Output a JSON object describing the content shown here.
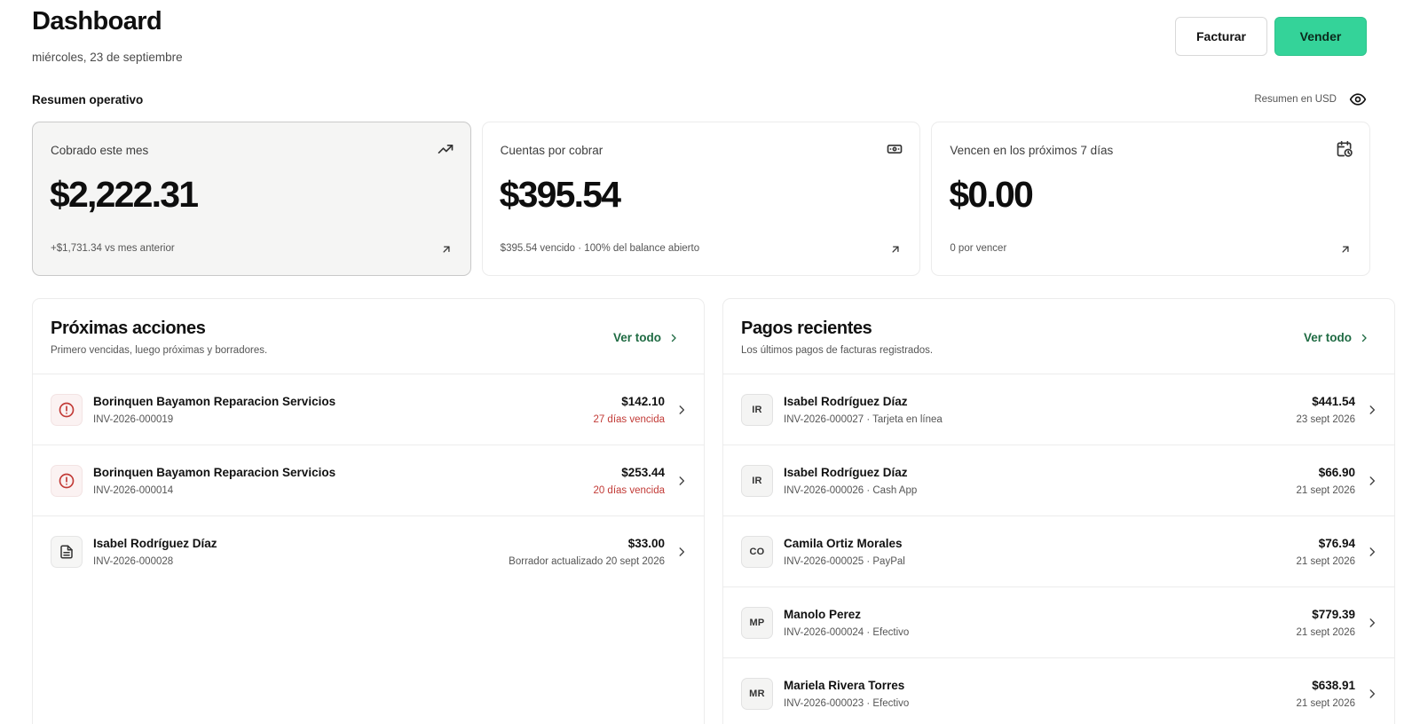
{
  "header": {
    "title": "Dashboard",
    "date": "miércoles, 23 de septiembre",
    "facturar_label": "Facturar",
    "vender_label": "Vender",
    "accent_color": "#34d399"
  },
  "overview": {
    "title": "Resumen operativo",
    "currency_label": "Resumen en USD",
    "toggle_icon": "eye-icon"
  },
  "cards": [
    {
      "label": "Cobrado este mes",
      "value": "$2,222.31",
      "footer": "+$1,731.34 vs mes anterior",
      "icon": "trending-up-icon",
      "active": true
    },
    {
      "label": "Cuentas por cobrar",
      "value": "$395.54",
      "footer": "$395.54 vencido · 100% del balance abierto",
      "icon": "banknote-icon",
      "active": false
    },
    {
      "label": "Vencen en los próximos 7 días",
      "value": "$0.00",
      "footer": "0 por vencer",
      "icon": "calendar-clock-icon",
      "active": false
    }
  ],
  "next_actions": {
    "title": "Próximas acciones",
    "subtitle": "Primero vencidas, luego próximas y borradores.",
    "see_all": "Ver todo",
    "items": [
      {
        "name": "Borinquen Bayamon Reparacion Servicios",
        "invoice": "INV-2026-000019",
        "amount": "$142.10",
        "status": "27 días vencida",
        "kind": "overdue",
        "icon": "alert-circle-icon"
      },
      {
        "name": "Borinquen Bayamon Reparacion Servicios",
        "invoice": "INV-2026-000014",
        "amount": "$253.44",
        "status": "20 días vencida",
        "kind": "overdue",
        "icon": "alert-circle-icon"
      },
      {
        "name": "Isabel Rodríguez Díaz",
        "invoice": "INV-2026-000028",
        "amount": "$33.00",
        "status": "Borrador actualizado 20 sept 2026",
        "kind": "draft",
        "icon": "document-icon"
      }
    ]
  },
  "recent_payments": {
    "title": "Pagos recientes",
    "subtitle": "Los últimos pagos de facturas registrados.",
    "see_all": "Ver todo",
    "items": [
      {
        "initials": "IR",
        "name": "Isabel Rodríguez Díaz",
        "detail": "INV-2026-000027 · Tarjeta en línea",
        "amount": "$441.54",
        "date": "23 sept 2026"
      },
      {
        "initials": "IR",
        "name": "Isabel Rodríguez Díaz",
        "detail": "INV-2026-000026 · Cash App",
        "amount": "$66.90",
        "date": "21 sept 2026"
      },
      {
        "initials": "CO",
        "name": "Camila Ortiz Morales",
        "detail": "INV-2026-000025 · PayPal",
        "amount": "$76.94",
        "date": "21 sept 2026"
      },
      {
        "initials": "MP",
        "name": "Manolo Perez",
        "detail": "INV-2026-000024 · Efectivo",
        "amount": "$779.39",
        "date": "21 sept 2026"
      },
      {
        "initials": "MR",
        "name": "Mariela Rivera Torres",
        "detail": "INV-2026-000023 · Efectivo",
        "amount": "$638.91",
        "date": "21 sept 2026"
      }
    ]
  },
  "colors": {
    "overdue": "#c23a36",
    "link": "#1f6b43"
  }
}
